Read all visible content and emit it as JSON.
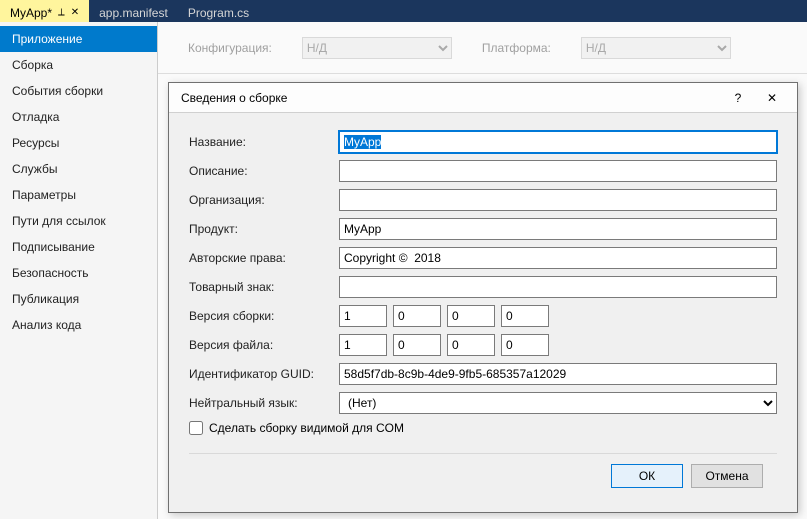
{
  "tabs": {
    "t0": {
      "label": "MyApp*"
    },
    "t1": {
      "label": "app.manifest"
    },
    "t2": {
      "label": "Program.cs"
    }
  },
  "sidebar": {
    "items": [
      "Приложение",
      "Сборка",
      "События сборки",
      "Отладка",
      "Ресурсы",
      "Службы",
      "Параметры",
      "Пути для ссылок",
      "Подписывание",
      "Безопасность",
      "Публикация",
      "Анализ кода"
    ]
  },
  "config": {
    "configuration_label": "Конфигурация:",
    "configuration_value": "Н/Д",
    "platform_label": "Платформа:",
    "platform_value": "Н/Д"
  },
  "dialog": {
    "title": "Сведения о сборке",
    "help": "?",
    "close": "✕",
    "labels": {
      "name": "Название:",
      "description": "Описание:",
      "organization": "Организация:",
      "product": "Продукт:",
      "copyright": "Авторские права:",
      "trademark": "Товарный знак:",
      "assembly_version": "Версия сборки:",
      "file_version": "Версия файла:",
      "guid": "Идентификатор GUID:",
      "neutral_lang": "Нейтральный язык:",
      "com_visible": "Сделать сборку видимой для COM"
    },
    "values": {
      "name": "MyApp",
      "description": "",
      "organization": "",
      "product": "MyApp",
      "copyright": "Copyright ©  2018",
      "trademark": "",
      "assembly_version": [
        "1",
        "0",
        "0",
        "0"
      ],
      "file_version": [
        "1",
        "0",
        "0",
        "0"
      ],
      "guid": "58d5f7db-8c9b-4de9-9fb5-685357a12029",
      "neutral_lang": "(Нет)",
      "com_visible": false
    },
    "buttons": {
      "ok": "ОК",
      "cancel": "Отмена"
    }
  }
}
